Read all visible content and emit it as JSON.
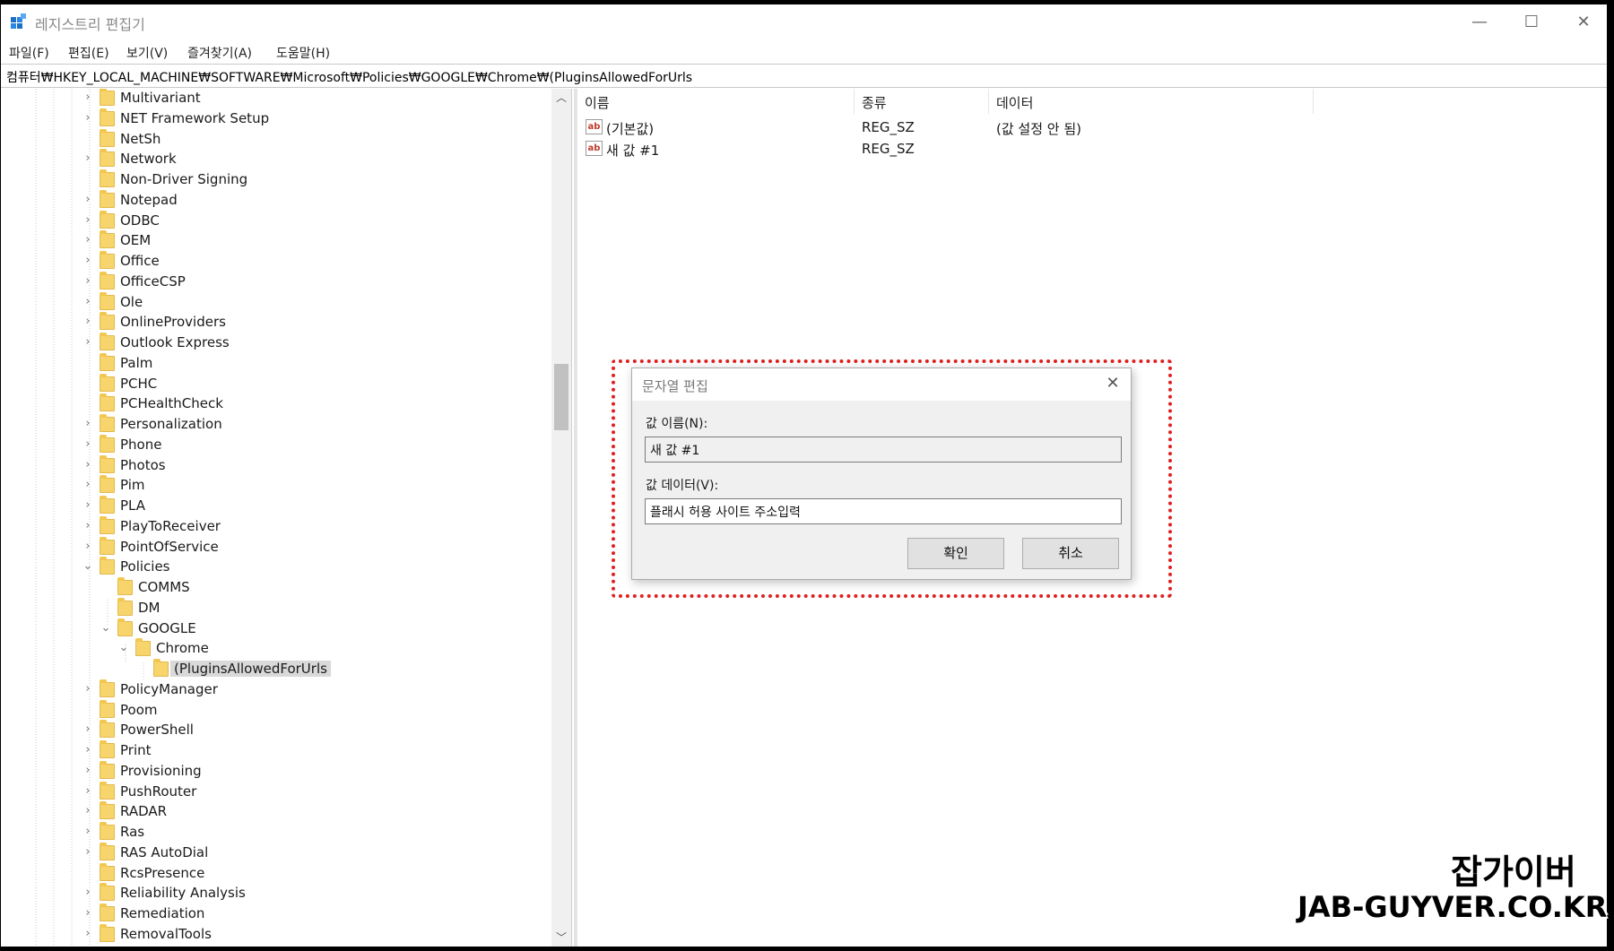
{
  "window": {
    "title": "레지스트리 편집기",
    "minimize_glyph": "—",
    "maximize_glyph": "☐",
    "close_glyph": "✕"
  },
  "menu": [
    {
      "label": "파일(F)"
    },
    {
      "label": "편집(E)"
    },
    {
      "label": "보기(V)"
    },
    {
      "label": "즐겨찾기(A)"
    },
    {
      "label": "도움말(H)"
    }
  ],
  "address": "컴퓨터₩HKEY_LOCAL_MACHINE₩SOFTWARE₩Microsoft₩Policies₩GOOGLE₩Chrome₩(PluginsAllowedForUrls",
  "tree": [
    {
      "label": "Multivariant",
      "expander": "›"
    },
    {
      "label": "NET Framework Setup",
      "expander": "›"
    },
    {
      "label": "NetSh",
      "expander": ""
    },
    {
      "label": "Network",
      "expander": "›"
    },
    {
      "label": "Non-Driver Signing",
      "expander": ""
    },
    {
      "label": "Notepad",
      "expander": "›"
    },
    {
      "label": "ODBC",
      "expander": "›"
    },
    {
      "label": "OEM",
      "expander": "›"
    },
    {
      "label": "Office",
      "expander": "›"
    },
    {
      "label": "OfficeCSP",
      "expander": "›"
    },
    {
      "label": "Ole",
      "expander": "›"
    },
    {
      "label": "OnlineProviders",
      "expander": "›"
    },
    {
      "label": "Outlook Express",
      "expander": "›"
    },
    {
      "label": "Palm",
      "expander": ""
    },
    {
      "label": "PCHC",
      "expander": ""
    },
    {
      "label": "PCHealthCheck",
      "expander": ""
    },
    {
      "label": "Personalization",
      "expander": "›"
    },
    {
      "label": "Phone",
      "expander": "›"
    },
    {
      "label": "Photos",
      "expander": "›"
    },
    {
      "label": "Pim",
      "expander": "›"
    },
    {
      "label": "PLA",
      "expander": "›"
    },
    {
      "label": "PlayToReceiver",
      "expander": "›"
    },
    {
      "label": "PointOfService",
      "expander": "›"
    },
    {
      "label": "Policies",
      "expander": "⌄"
    },
    {
      "label": "COMMS",
      "expander": ""
    },
    {
      "label": "DM",
      "expander": ""
    },
    {
      "label": "GOOGLE",
      "expander": "⌄"
    },
    {
      "label": "Chrome",
      "expander": "⌄"
    },
    {
      "label": "(PluginsAllowedForUrls",
      "expander": ""
    },
    {
      "label": "PolicyManager",
      "expander": "›"
    },
    {
      "label": "Poom",
      "expander": ""
    },
    {
      "label": "PowerShell",
      "expander": "›"
    },
    {
      "label": "Print",
      "expander": "›"
    },
    {
      "label": "Provisioning",
      "expander": "›"
    },
    {
      "label": "PushRouter",
      "expander": "›"
    },
    {
      "label": "RADAR",
      "expander": "›"
    },
    {
      "label": "Ras",
      "expander": "›"
    },
    {
      "label": "RAS AutoDial",
      "expander": "›"
    },
    {
      "label": "RcsPresence",
      "expander": ""
    },
    {
      "label": "Reliability Analysis",
      "expander": "›"
    },
    {
      "label": "Remediation",
      "expander": "›"
    },
    {
      "label": "RemovalTools",
      "expander": "›"
    }
  ],
  "scroll": {
    "up_glyph": "︿",
    "down_glyph": "﹀"
  },
  "values": {
    "columns": [
      "이름",
      "종류",
      "데이터"
    ],
    "icon_text": "ab",
    "rows": [
      {
        "name": "(기본값)",
        "type": "REG_SZ",
        "data": "(값 설정 안 됨)"
      },
      {
        "name": "새 값 #1",
        "type": "REG_SZ",
        "data": ""
      }
    ]
  },
  "dialog": {
    "title": "문자열 편집",
    "close_glyph": "✕",
    "name_label": "값 이름(N):",
    "name_value": "새 값 #1",
    "data_label": "값 데이터(V):",
    "data_value": "플래시 허용 사이트 주소입력",
    "ok_label": "확인",
    "cancel_label": "취소"
  },
  "watermark": {
    "korean": "잡가이버",
    "url": "JAB-GUYVER.CO.KR"
  },
  "colors": {
    "highlight_border": "#e02020",
    "folder": "#f7d56c",
    "selected_bg": "#d9d9d9"
  }
}
